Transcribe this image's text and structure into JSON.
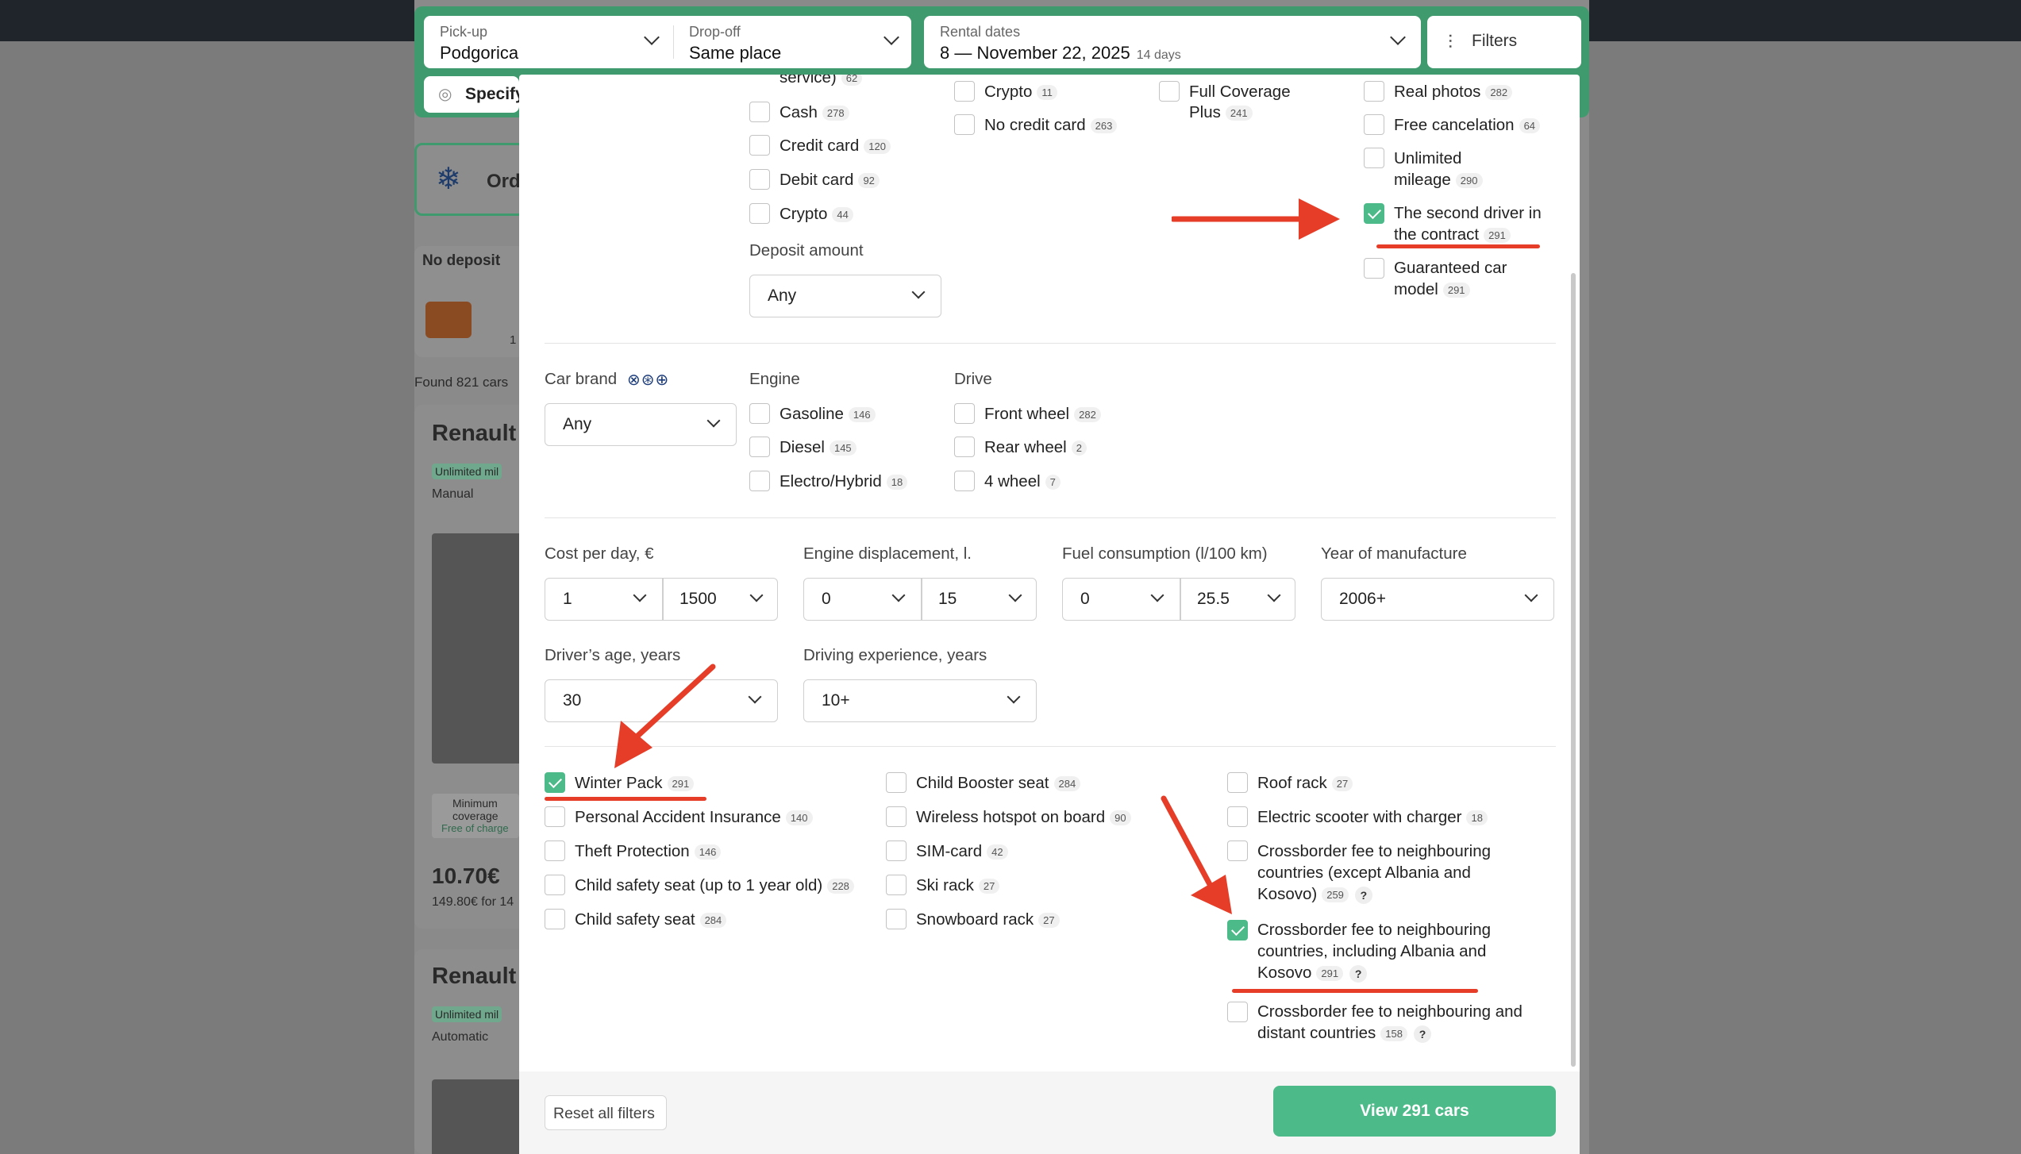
{
  "search": {
    "pickup_label": "Pick-up",
    "pickup_value": "Podgorica",
    "dropoff_label": "Drop-off",
    "dropoff_value": "Same place",
    "dates_label": "Rental dates",
    "dates_value": "8 — November 22, 2025",
    "dates_days": "14 days",
    "filters_label": "Filters",
    "specify_label": "Specify"
  },
  "background": {
    "order_label": "Ord",
    "no_deposit": "No deposit",
    "deposit_count": "1",
    "found": "Found 821 cars",
    "card1_title": "Renault",
    "card1_badge": "Unlimited mil",
    "card1_gear": "Manual",
    "card1_cover1": "Minimum",
    "card1_cover2": "coverage",
    "card1_cover3": "Free of charge",
    "card1_price": "10.70€",
    "card1_total": "149.80€ for 14",
    "card2_title": "Renault",
    "card2_badge": "Unlimited mil",
    "card2_gear": "Automatic"
  },
  "payment": {
    "partial_top": "service)",
    "partial_top_count": "62",
    "items": [
      {
        "label": "Cash",
        "count": "278",
        "checked": false
      },
      {
        "label": "Credit card",
        "count": "120",
        "checked": false
      },
      {
        "label": "Debit card",
        "count": "92",
        "checked": false
      },
      {
        "label": "Crypto",
        "count": "44",
        "checked": false
      }
    ],
    "deposit_label": "Deposit amount",
    "deposit_value": "Any"
  },
  "deposit_col": {
    "items": [
      {
        "label": "Crypto",
        "count": "11",
        "checked": false
      },
      {
        "label": "No credit card",
        "count": "263",
        "checked": false
      }
    ]
  },
  "insurance": {
    "label1": "Full Coverage",
    "label2": "Plus",
    "count": "241",
    "checked": false
  },
  "features": {
    "real_photos": {
      "label": "Real photos",
      "count": "282",
      "checked": false
    },
    "free_cancel": {
      "label": "Free cancelation",
      "count": "64",
      "checked": false
    },
    "unlimited1": "Unlimited",
    "unlimited2": "mileage",
    "unlimited_count": "290",
    "second_driver1": "The second driver in",
    "second_driver2": "the contract",
    "second_driver_count": "291",
    "guaranteed1": "Guaranteed car",
    "guaranteed2": "model",
    "guaranteed_count": "291"
  },
  "car": {
    "brand_label": "Car brand",
    "brand_value": "Any",
    "engine_label": "Engine",
    "engine": [
      {
        "label": "Gasoline",
        "count": "146"
      },
      {
        "label": "Diesel",
        "count": "145"
      },
      {
        "label": "Electro/Hybrid",
        "count": "18"
      }
    ],
    "drive_label": "Drive",
    "drive": [
      {
        "label": "Front wheel",
        "count": "282"
      },
      {
        "label": "Rear wheel",
        "count": "2"
      },
      {
        "label": "4 wheel",
        "count": "7"
      }
    ]
  },
  "ranges": {
    "cost_label": "Cost per day, €",
    "cost_min": "1",
    "cost_max": "1500",
    "disp_label": "Engine displacement, l.",
    "disp_min": "0",
    "disp_max": "15",
    "fuel_label": "Fuel consumption (l/100 km)",
    "fuel_min": "0",
    "fuel_max": "25.5",
    "year_label": "Year of manufacture",
    "year_value": "2006+",
    "age_label": "Driver’s age, years",
    "age_value": "30",
    "exp_label": "Driving experience, years",
    "exp_value": "10+"
  },
  "extras": {
    "col1": [
      {
        "label": "Winter Pack",
        "count": "291",
        "checked": true
      },
      {
        "label": "Personal Accident Insurance",
        "count": "140",
        "checked": false
      },
      {
        "label": "Theft Protection",
        "count": "146",
        "checked": false
      },
      {
        "label": "Child safety seat (up to 1 year old)",
        "count": "228",
        "checked": false
      },
      {
        "label": "Child safety seat",
        "count": "284",
        "checked": false
      }
    ],
    "col2": [
      {
        "label": "Child Booster seat",
        "count": "284",
        "checked": false
      },
      {
        "label": "Wireless hotspot on board",
        "count": "90",
        "checked": false
      },
      {
        "label": "SIM-card",
        "count": "42",
        "checked": false
      },
      {
        "label": "Ski rack",
        "count": "27",
        "checked": false
      },
      {
        "label": "Snowboard rack",
        "count": "27",
        "checked": false
      }
    ],
    "roof": {
      "label": "Roof rack",
      "count": "27"
    },
    "scooter": {
      "label": "Electric scooter with charger",
      "count": "18"
    },
    "cb1_l1": "Crossborder fee to neighbouring",
    "cb1_l2": "countries (except Albania and",
    "cb1_l3": "Kosovo)",
    "cb1_count": "259",
    "cb2_l1": "Crossborder fee to neighbouring",
    "cb2_l2": "countries, including Albania and",
    "cb2_l3": "Kosovo",
    "cb2_count": "291",
    "cb3_l1": "Crossborder fee to neighbouring and",
    "cb3_l2": "distant countries",
    "cb3_count": "158",
    "help_glyph": "?"
  },
  "footer": {
    "reset": "Reset all filters",
    "view": "View 291 cars"
  },
  "colors": {
    "brand_green": "#3f9a6d",
    "check_green": "#4dba8a",
    "annotation_red": "#e53d28"
  }
}
